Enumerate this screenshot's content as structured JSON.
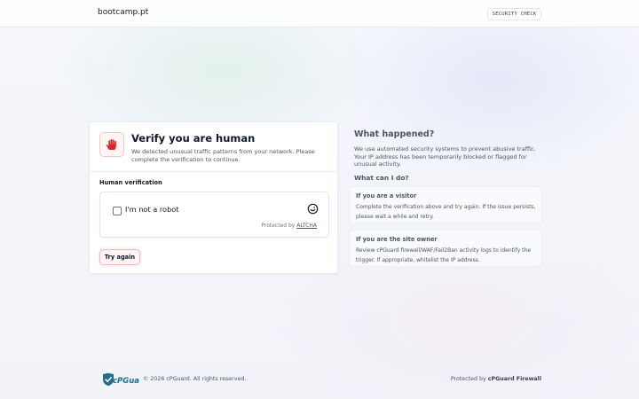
{
  "header": {
    "domain": "bootcamp.pt",
    "badge": "SECURITY CHECK"
  },
  "card": {
    "title": "Verify you are human",
    "description": "We detected unusual traffic patterns from your network. Please complete the verification to continue.",
    "section_label": "Human verification",
    "captcha": {
      "checkbox_label": "I'm not a robot",
      "checked": false,
      "protected_prefix": "Protected by",
      "protected_link": "ALTCHA"
    },
    "retry_label": "Try again"
  },
  "side": {
    "title": "What happened?",
    "text": "We use automated security systems to prevent abusive traffic. Your IP address has been temporarily blocked or flagged for unusual activity.",
    "subtitle": "What can I do?",
    "visitor": {
      "title": "If you are a visitor",
      "text": "Complete the verification above and try again. If the issue persists, please wait a while and retry."
    },
    "owner": {
      "title": "If you are the site owner",
      "text": "Review cPGuard firewall/WAF/Fail2Ban activity logs to identify the trigger. If appropriate, whitelist the IP address."
    }
  },
  "footer": {
    "logo_text": "cPGuard",
    "copyright": "© 2026 cPGuard. All rights reserved.",
    "protected_prefix": "Protected by",
    "protected_brand": "cPGuard Firewall"
  },
  "colors": {
    "accent_red": "#d62828",
    "logo_teal": "#1f6f8b"
  },
  "icons": {
    "hand": "stop-hand-icon",
    "captcha_logo": "altcha-logo-icon",
    "footer_logo": "cpguard-logo"
  }
}
